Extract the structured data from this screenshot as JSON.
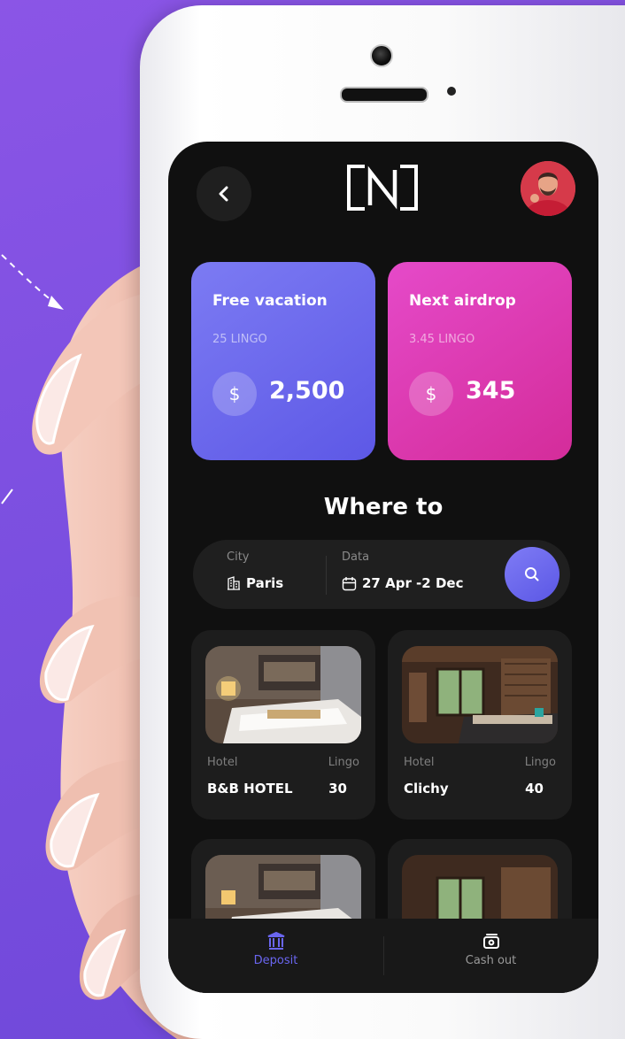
{
  "header": {
    "back_icon": "chevron-left-icon",
    "logo_icon": "n-logo-icon",
    "avatar_icon": "user-avatar"
  },
  "cards": [
    {
      "title": "Free vacation",
      "subtitle": "25 LINGO",
      "currency": "$",
      "amount": "2,500",
      "color": "#6b67ec"
    },
    {
      "title": "Next airdrop",
      "subtitle": "3.45 LINGO",
      "currency": "$",
      "amount": "345",
      "color": "#dd3bb2"
    }
  ],
  "section_title": "Where to",
  "search": {
    "city_label": "City",
    "city_value": "Paris",
    "date_label": "Data",
    "date_value": "27 Apr -2 Dec",
    "search_icon": "search-icon"
  },
  "hotels": [
    {
      "type_label": "Hotel",
      "price_label": "Lingo",
      "name": "B&B HOTEL",
      "price": "30"
    },
    {
      "type_label": "Hotel",
      "price_label": "Lingo",
      "name": "Clichy",
      "price": "40"
    }
  ],
  "nav": {
    "deposit_label": "Deposit",
    "cashout_label": "Cash out",
    "active_color": "#6a66f0"
  }
}
